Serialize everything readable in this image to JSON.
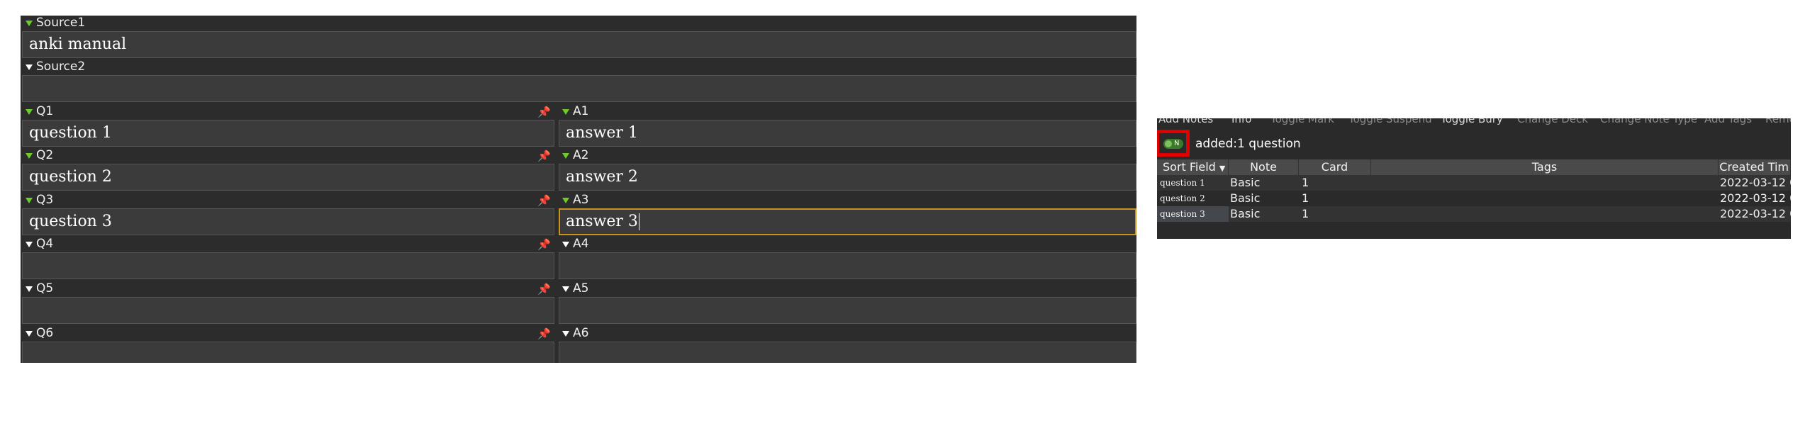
{
  "editor": {
    "fields": [
      {
        "label": "Source1",
        "value": "anki manual"
      },
      {
        "label": "Source2",
        "value": ""
      },
      {
        "label": "Q1",
        "value": "question 1"
      },
      {
        "label": "A1",
        "value": "answer 1"
      },
      {
        "label": "Q2",
        "value": "question 2"
      },
      {
        "label": "A2",
        "value": "answer 2"
      },
      {
        "label": "Q3",
        "value": "question 3"
      },
      {
        "label": "A3",
        "value": "answer 3"
      },
      {
        "label": "Q4",
        "value": ""
      },
      {
        "label": "A4",
        "value": ""
      },
      {
        "label": "Q5",
        "value": ""
      },
      {
        "label": "A5",
        "value": ""
      },
      {
        "label": "Q6",
        "value": ""
      },
      {
        "label": "A6",
        "value": ""
      }
    ]
  },
  "browser": {
    "menu": [
      "Add Notes",
      "Info",
      "Toggle Mark",
      "Toggle Suspend",
      "Toggle Bury",
      "Change Deck",
      "Change Note Type",
      "Add Tags",
      "Remove Tags"
    ],
    "toggle_label": "N",
    "search_value": "added:1 question",
    "columns": [
      "Sort Field",
      "Note",
      "Card",
      "Tags",
      "Created Tim"
    ],
    "rows": [
      {
        "sort_field": "question 1",
        "note": "Basic",
        "card": "1",
        "tags": "",
        "created": "2022-03-12 0"
      },
      {
        "sort_field": "question 2",
        "note": "Basic",
        "card": "1",
        "tags": "",
        "created": "2022-03-12 0"
      },
      {
        "sort_field": "question 3",
        "note": "Basic",
        "card": "1",
        "tags": "",
        "created": "2022-03-12 0"
      }
    ]
  },
  "colors": {
    "accent_green": "#6dcc2a",
    "focus_border": "#c8941f",
    "highlight_red": "#e00000"
  }
}
